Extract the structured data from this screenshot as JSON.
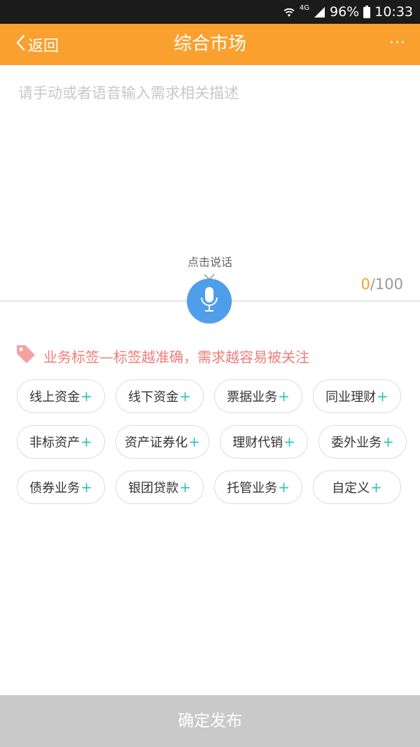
{
  "status_bar": {
    "network": "4G",
    "battery": "96%",
    "time": "10:33"
  },
  "nav": {
    "back_label": "返回",
    "title": "综合市场",
    "more_label": "···"
  },
  "input": {
    "placeholder": "请手动或者语音输入需求相关描述",
    "value": "",
    "speak_hint": "点击说话",
    "count_current": "0",
    "count_max": "/100"
  },
  "tags": {
    "header": "业务标签—标签越准确，需求越容易被关注",
    "plus": "+",
    "items": [
      {
        "label": "线上资金"
      },
      {
        "label": "线下资金"
      },
      {
        "label": "票据业务"
      },
      {
        "label": "同业理财"
      },
      {
        "label": "非标资产"
      },
      {
        "label": "资产证券化"
      },
      {
        "label": "理财代销"
      },
      {
        "label": "委外业务"
      },
      {
        "label": "债券业务"
      },
      {
        "label": "银团贷款"
      },
      {
        "label": "托管业务"
      },
      {
        "label": "自定义"
      }
    ]
  },
  "submit_label": "确定发布",
  "colors": {
    "brand": "#f9a02f",
    "mic": "#4f9eea",
    "tag_header": "#ee7d7a",
    "plus": "#2cc6b5",
    "submit_disabled": "#c9c9c9"
  },
  "icons": {
    "back": "chevron-left-icon",
    "more": "more-dots-icon",
    "mic": "microphone-icon",
    "tag": "tag-icon",
    "wifi": "wifi-icon",
    "signal": "signal-icon",
    "battery": "battery-icon"
  }
}
